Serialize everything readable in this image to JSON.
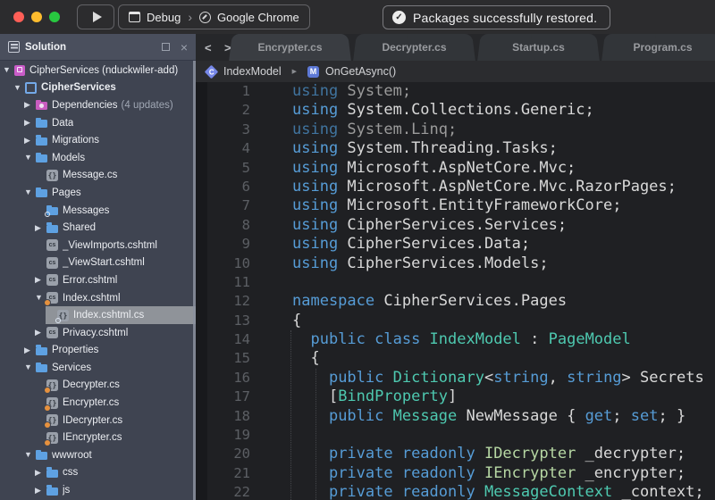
{
  "window": {
    "notification": "Packages successfully restored.",
    "run_config": "Debug",
    "run_target": "Google Chrome"
  },
  "colors": {
    "keyword": "#569cd6",
    "type": "#4ec9b0",
    "interface": "#b6d7a3",
    "folder_icon": "#5ea1e2",
    "nuget_icon": "#c95cc0",
    "modified_dot": "#e6913e",
    "traffic_red": "#ff5f57",
    "traffic_yellow": "#febc2e",
    "traffic_green": "#28c840"
  },
  "sidebar": {
    "title": "Solution",
    "items": [
      {
        "label": "CipherServices (nduckwiler-add)",
        "level": 0,
        "arrow": "open",
        "icon": "solution"
      },
      {
        "label": "CipherServices",
        "level": 1,
        "arrow": "open",
        "icon": "project",
        "bold": true
      },
      {
        "label": "Dependencies",
        "suffix": "(4 updates)",
        "level": 2,
        "arrow": "closed",
        "icon": "nuget"
      },
      {
        "label": "Data",
        "level": 2,
        "arrow": "closed",
        "icon": "folder"
      },
      {
        "label": "Migrations",
        "level": 2,
        "arrow": "closed",
        "icon": "folder"
      },
      {
        "label": "Models",
        "level": 2,
        "arrow": "open",
        "icon": "folder"
      },
      {
        "label": "Message.cs",
        "level": 3,
        "arrow": null,
        "icon": "cs"
      },
      {
        "label": "Pages",
        "level": 2,
        "arrow": "open",
        "icon": "folder"
      },
      {
        "label": "Messages",
        "level": 3,
        "arrow": null,
        "icon": "folder",
        "dot": "ring"
      },
      {
        "label": "Shared",
        "level": 3,
        "arrow": "closed",
        "icon": "folder"
      },
      {
        "label": "_ViewImports.cshtml",
        "level": 3,
        "arrow": null,
        "icon": "cshtml"
      },
      {
        "label": "_ViewStart.cshtml",
        "level": 3,
        "arrow": null,
        "icon": "cshtml"
      },
      {
        "label": "Error.cshtml",
        "level": 3,
        "arrow": "closed",
        "icon": "cshtml"
      },
      {
        "label": "Index.cshtml",
        "level": 3,
        "arrow": "open",
        "icon": "cshtml",
        "dot": "orange"
      },
      {
        "label": "Index.cshtml.cs",
        "level": 4,
        "arrow": null,
        "icon": "cs",
        "selected": true,
        "dot": "ring"
      },
      {
        "label": "Privacy.cshtml",
        "level": 3,
        "arrow": "closed",
        "icon": "cshtml"
      },
      {
        "label": "Properties",
        "level": 2,
        "arrow": "closed",
        "icon": "folder"
      },
      {
        "label": "Services",
        "level": 2,
        "arrow": "open",
        "icon": "folder"
      },
      {
        "label": "Decrypter.cs",
        "level": 3,
        "arrow": null,
        "icon": "cs",
        "dot": "orange"
      },
      {
        "label": "Encrypter.cs",
        "level": 3,
        "arrow": null,
        "icon": "cs",
        "dot": "orange"
      },
      {
        "label": "IDecrypter.cs",
        "level": 3,
        "arrow": null,
        "icon": "cs",
        "dot": "orange"
      },
      {
        "label": "IEncrypter.cs",
        "level": 3,
        "arrow": null,
        "icon": "cs",
        "dot": "orange"
      },
      {
        "label": "wwwroot",
        "level": 2,
        "arrow": "open",
        "icon": "folder"
      },
      {
        "label": "css",
        "level": 3,
        "arrow": "closed",
        "icon": "folder"
      },
      {
        "label": "js",
        "level": 3,
        "arrow": "closed",
        "icon": "folder"
      }
    ]
  },
  "editor": {
    "tabs": [
      {
        "label": "Encrypter.cs",
        "active": true
      },
      {
        "label": "Decrypter.cs",
        "active": false
      },
      {
        "label": "Startup.cs",
        "active": false
      },
      {
        "label": "Program.cs",
        "active": false
      }
    ],
    "breadcrumb": {
      "type_name": "IndexModel",
      "member": "OnGetAsync()"
    },
    "code_lines": [
      {
        "n": 1,
        "s": [
          [
            "using ",
            "kd"
          ],
          [
            "System;",
            "dm"
          ]
        ]
      },
      {
        "n": 2,
        "s": [
          [
            "using ",
            "kw"
          ],
          [
            "System.Collections.Generic;",
            "pl"
          ]
        ]
      },
      {
        "n": 3,
        "s": [
          [
            "using ",
            "kd"
          ],
          [
            "System.Linq;",
            "dm"
          ]
        ]
      },
      {
        "n": 4,
        "s": [
          [
            "using ",
            "kw"
          ],
          [
            "System.Threading.Tasks;",
            "pl"
          ]
        ]
      },
      {
        "n": 5,
        "s": [
          [
            "using ",
            "kw"
          ],
          [
            "Microsoft.AspNetCore.Mvc;",
            "pl"
          ]
        ]
      },
      {
        "n": 6,
        "s": [
          [
            "using ",
            "kw"
          ],
          [
            "Microsoft.AspNetCore.Mvc.RazorPages;",
            "pl"
          ]
        ]
      },
      {
        "n": 7,
        "s": [
          [
            "using ",
            "kw"
          ],
          [
            "Microsoft.EntityFrameworkCore;",
            "pl"
          ]
        ]
      },
      {
        "n": 8,
        "s": [
          [
            "using ",
            "kw"
          ],
          [
            "CipherServices.Services;",
            "pl"
          ]
        ]
      },
      {
        "n": 9,
        "s": [
          [
            "using ",
            "kw"
          ],
          [
            "CipherServices.Data;",
            "pl"
          ]
        ]
      },
      {
        "n": 10,
        "s": [
          [
            "using ",
            "kw"
          ],
          [
            "CipherServices.Models;",
            "pl"
          ]
        ]
      },
      {
        "n": 11,
        "s": []
      },
      {
        "n": 12,
        "s": [
          [
            "namespace ",
            "kw"
          ],
          [
            "CipherServices.Pages",
            "pl"
          ]
        ]
      },
      {
        "n": 13,
        "s": [
          [
            "{",
            "pl"
          ]
        ]
      },
      {
        "n": 14,
        "s": [
          [
            "  ",
            "pl"
          ],
          [
            "public class ",
            "kw"
          ],
          [
            "IndexModel",
            "ty"
          ],
          [
            " : ",
            "pl"
          ],
          [
            "PageModel",
            "ty"
          ]
        ]
      },
      {
        "n": 15,
        "s": [
          [
            "  {",
            "pl"
          ]
        ]
      },
      {
        "n": 16,
        "s": [
          [
            "    ",
            "pl"
          ],
          [
            "public ",
            "kw"
          ],
          [
            "Dictionary",
            "ty"
          ],
          [
            "<",
            "pl"
          ],
          [
            "string",
            "kw"
          ],
          [
            ", ",
            "pl"
          ],
          [
            "string",
            "kw"
          ],
          [
            "> ",
            "pl"
          ],
          [
            "Secrets",
            "pl"
          ]
        ]
      },
      {
        "n": 17,
        "s": [
          [
            "    [",
            "pl"
          ],
          [
            "BindProperty",
            "ty"
          ],
          [
            "]",
            "pl"
          ]
        ]
      },
      {
        "n": 18,
        "s": [
          [
            "    ",
            "pl"
          ],
          [
            "public ",
            "kw"
          ],
          [
            "Message",
            "ty"
          ],
          [
            " NewMessage { ",
            "pl"
          ],
          [
            "get",
            "kw"
          ],
          [
            "; ",
            "pl"
          ],
          [
            "set",
            "kw"
          ],
          [
            "; }",
            "pl"
          ]
        ]
      },
      {
        "n": 19,
        "s": []
      },
      {
        "n": 20,
        "s": [
          [
            "    ",
            "pl"
          ],
          [
            "private readonly ",
            "kw"
          ],
          [
            "IDecrypter",
            "if"
          ],
          [
            " _decrypter;",
            "pl"
          ]
        ]
      },
      {
        "n": 21,
        "s": [
          [
            "    ",
            "pl"
          ],
          [
            "private readonly ",
            "kw"
          ],
          [
            "IEncrypter",
            "if"
          ],
          [
            " _encrypter;",
            "pl"
          ]
        ]
      },
      {
        "n": 22,
        "s": [
          [
            "    ",
            "pl"
          ],
          [
            "private readonly ",
            "kw"
          ],
          [
            "MessageContext",
            "ty"
          ],
          [
            " _context;",
            "pl"
          ]
        ]
      }
    ]
  }
}
